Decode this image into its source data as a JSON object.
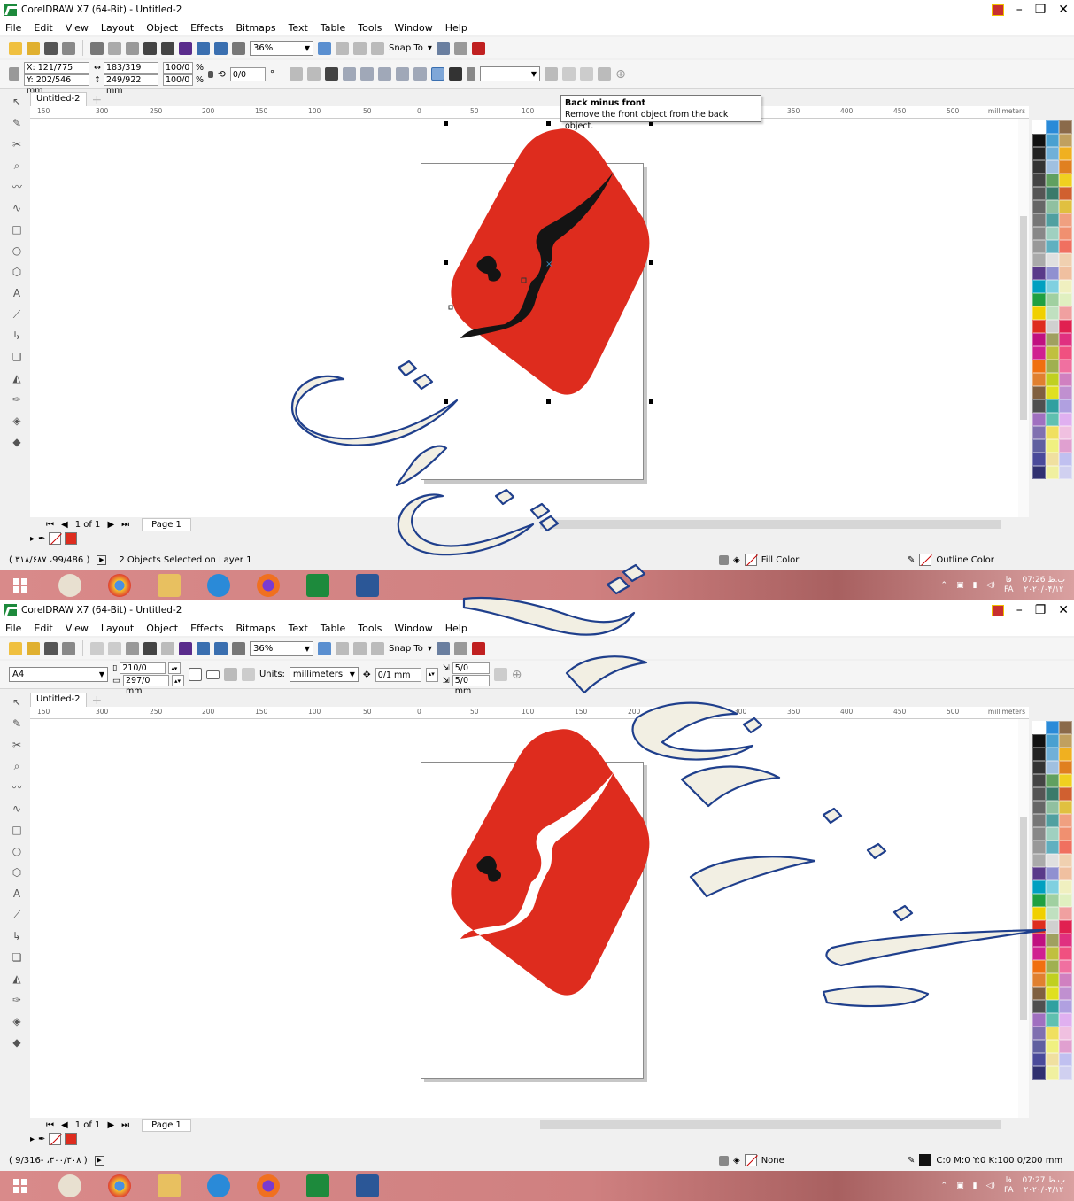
{
  "app": {
    "title": "CorelDRAW X7 (64-Bit) - Untitled-2"
  },
  "menu": [
    "File",
    "Edit",
    "View",
    "Layout",
    "Object",
    "Effects",
    "Bitmaps",
    "Text",
    "Table",
    "Tools",
    "Window",
    "Help"
  ],
  "toolbar": {
    "zoom": "36%",
    "snap_to": "Snap To"
  },
  "shot1": {
    "prop": {
      "x": "X: 121/775 mm",
      "y": "Y: 202/546 mm",
      "w": "183/319 mm",
      "h": "249/922 mm",
      "sx": "100/0",
      "sy": "100/0",
      "pct": "%",
      "angle": "0/0",
      "deg": "°"
    },
    "tooltip": {
      "title": "Back minus front",
      "desc": "Remove the front object from the back object."
    },
    "status_coord": "( ۳۱۸/۶۸۷ ،99/486 )",
    "status_msg": "2 Objects Selected on Layer 1",
    "fill": "Fill Color",
    "outline": "Outline Color",
    "clock_time": "07:26 ب.ظ",
    "clock_date": "۲۰۲۰/۰۴/۱۲"
  },
  "shot2": {
    "prop": {
      "page_size": "A4",
      "w": "210/0 mm",
      "h": "297/0 mm",
      "units_label": "Units:",
      "units": "millimeters",
      "nudge": "0/1 mm",
      "dup_x": "5/0 mm",
      "dup_y": "5/0 mm"
    },
    "status_coord": "( 9/316- ،۳۰۰/۳۰۸ )",
    "fill": "None",
    "outline": "C:0 M:0 Y:0 K:100  0/200 mm",
    "clock_time": "07:27 ب.ظ",
    "clock_date": "۲۰۲۰/۰۴/۱۲"
  },
  "doc": {
    "tab": "Untitled-2",
    "page_of": "1 of 1",
    "page_tab": "Page 1"
  },
  "ruler": {
    "ticks": [
      "150",
      "300",
      "250",
      "200",
      "150",
      "100",
      "50",
      "0",
      "50",
      "100",
      "150",
      "200",
      "250",
      "300",
      "350",
      "400",
      "450",
      "500"
    ],
    "unit": "millimeters",
    "v_unit": "millimeters"
  },
  "taskbar": {
    "lang": "FA",
    "ime": "فا"
  },
  "icons": [
    "pick-tool-icon",
    "shape-tool-icon",
    "crop-tool-icon",
    "zoom-tool-icon",
    "freehand-tool-icon",
    "artistic-media-icon",
    "rectangle-tool-icon",
    "ellipse-tool-icon",
    "polygon-tool-icon",
    "text-tool-icon",
    "dimension-tool-icon",
    "connector-tool-icon",
    "drop-shadow-icon",
    "transparency-icon",
    "eyedropper-icon",
    "interactive-fill-icon",
    "smart-fill-icon"
  ],
  "colors": {
    "accent_red": "#de2c1e",
    "shape_black": "#141414",
    "watermark_stroke": "#1f3f8c",
    "watermark_fill": "#f2efe3"
  }
}
